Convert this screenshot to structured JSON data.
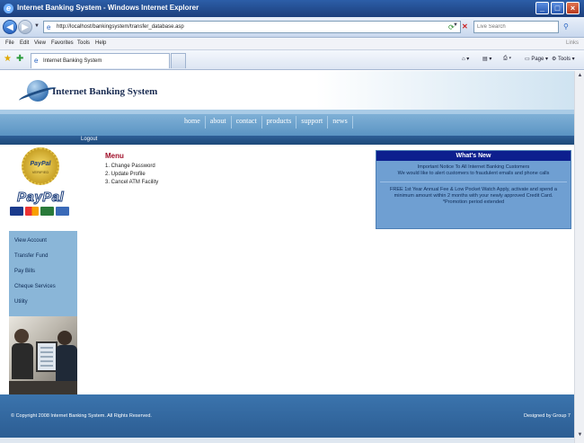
{
  "browser": {
    "window_title": "Internet Banking System - Windows Internet Explorer",
    "url": "http://localhost/bankingsystem/transfer_database.asp",
    "search_placeholder": "Live Search",
    "menu": [
      "File",
      "Edit",
      "View",
      "Favorites",
      "Tools",
      "Help"
    ],
    "links_label": "Links",
    "tab_label": "Internet Banking System",
    "page_label": "Page",
    "tools_label": "Tools"
  },
  "site": {
    "logo_text": "Internet Banking System",
    "nav": [
      "home",
      "about",
      "contact",
      "products",
      "support",
      "news"
    ],
    "logout": "Logout",
    "paypal_seal_title": "PayPal",
    "paypal_seal_sub": "VERIFIED",
    "paypal_logo": "PayPal",
    "sidebar_links": [
      "View Account",
      "Transfer Fund",
      "Pay Bills",
      "Cheque Services",
      "Utility"
    ],
    "menu_title": "Menu",
    "menu_items": [
      "1. Change Password",
      "2. Update Profile",
      "3. Cancel ATM Facility"
    ],
    "whats_new": {
      "title": "What's New",
      "notice_title": "Important Notice To All Internet Banking Customers",
      "notice_body": "We would like to alert customers to fraudulent emails and phone calls",
      "promo": "FREE 1st Year Annual Fee & Low Pocket Watch Apply, activate and spend a minimum amount within 2 months with your newly approved Credit Card. *Promotion period extended"
    },
    "footer_copyright": "© Copyright 2008 Internet Banking System. All Rights Reserved.",
    "footer_design": "Designed by Group 7"
  },
  "icons": {
    "back": "back-arrow-icon",
    "forward": "forward-arrow-icon",
    "refresh": "refresh-icon",
    "stop": "stop-icon",
    "search": "search-icon"
  }
}
